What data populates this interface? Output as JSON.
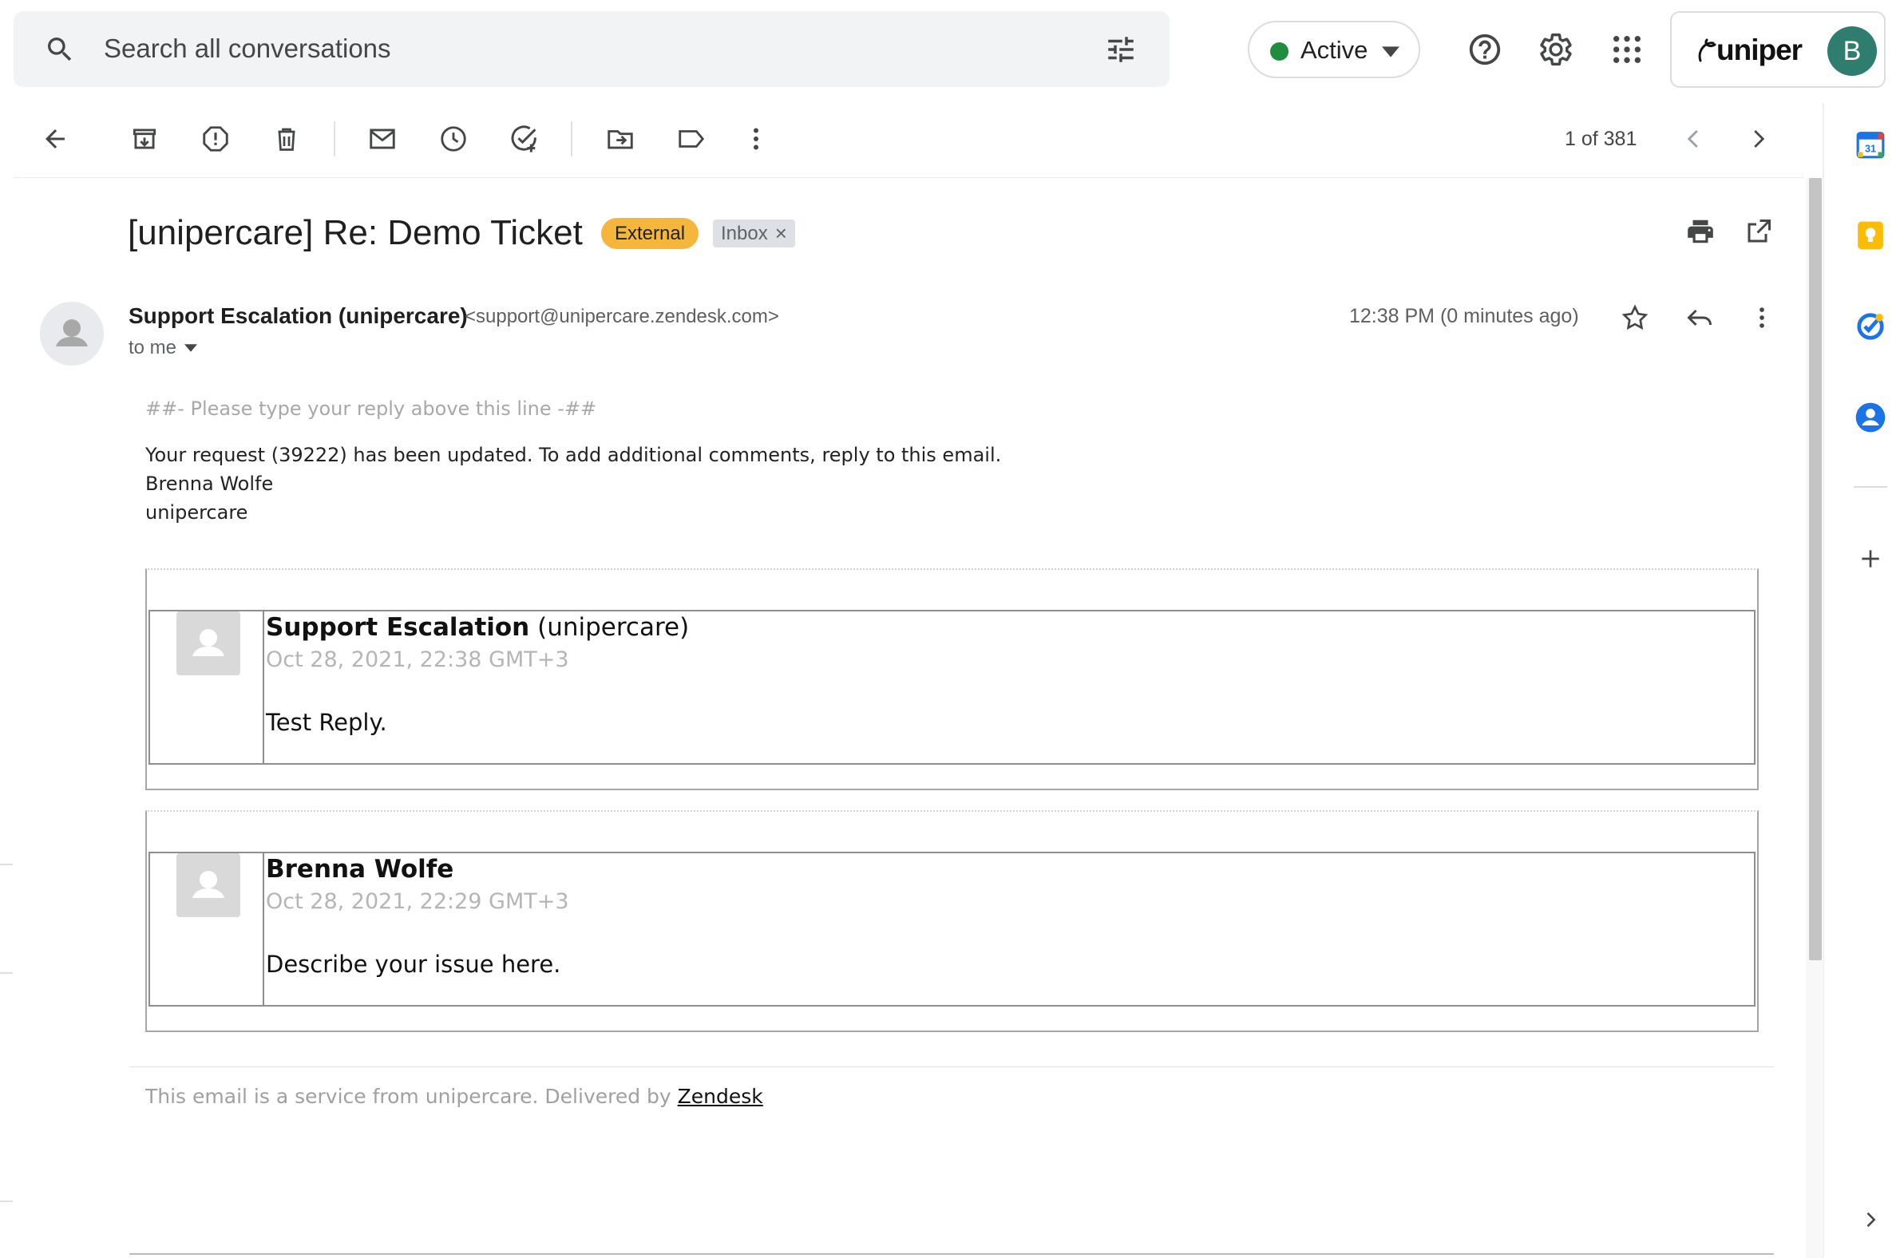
{
  "search": {
    "placeholder": "Search all conversations"
  },
  "status": {
    "label": "Active",
    "color": "#1e8e3e"
  },
  "header_icons": [
    "help-icon",
    "settings-icon",
    "apps-grid-icon"
  ],
  "account": {
    "brand": "uniper",
    "avatar_letter": "B",
    "avatar_color": "#2e7d6e"
  },
  "toolbar": {
    "pager": "1 of 381",
    "icons": [
      "back-arrow-icon",
      "archive-icon",
      "report-spam-icon",
      "delete-icon",
      "mark-unread-icon",
      "snooze-icon",
      "add-task-icon",
      "move-to-icon",
      "label-icon",
      "more-vert-icon",
      "prev-icon",
      "next-icon"
    ]
  },
  "email": {
    "subject": "[unipercare] Re: Demo Ticket",
    "badges": {
      "external": "External",
      "external_color": "#f4b73c",
      "inbox": "Inbox",
      "inbox_close": "×"
    },
    "sender": {
      "name": "Support Escalation (unipercare)",
      "email": "<support@unipercare.zendesk.com>",
      "to": "to me",
      "time": "12:38 PM (0 minutes ago)"
    },
    "body": {
      "reply_marker": "##- Please type your reply above this line -##",
      "update_line": "Your request (39222) has been updated. To add additional comments, reply to this email.",
      "agent": "Brenna Wolfe",
      "org": "unipercare"
    },
    "comments": [
      {
        "author_bold": "Support Escalation",
        "author_rest": " (unipercare)",
        "date": "Oct 28, 2021, 22:38 GMT+3",
        "text": "Test Reply."
      },
      {
        "author_bold": "Brenna Wolfe",
        "author_rest": "",
        "date": "Oct 28, 2021, 22:29 GMT+3",
        "text": "Describe your issue here."
      }
    ],
    "footer": {
      "prefix": "This email is a service from unipercare. Delivered by ",
      "link": "Zendesk"
    }
  },
  "side_panel": {
    "calendar_day": "31",
    "icons": [
      "calendar-icon",
      "keep-icon",
      "tasks-icon",
      "contacts-icon",
      "add-addon-icon",
      "expand-panel-icon"
    ]
  }
}
